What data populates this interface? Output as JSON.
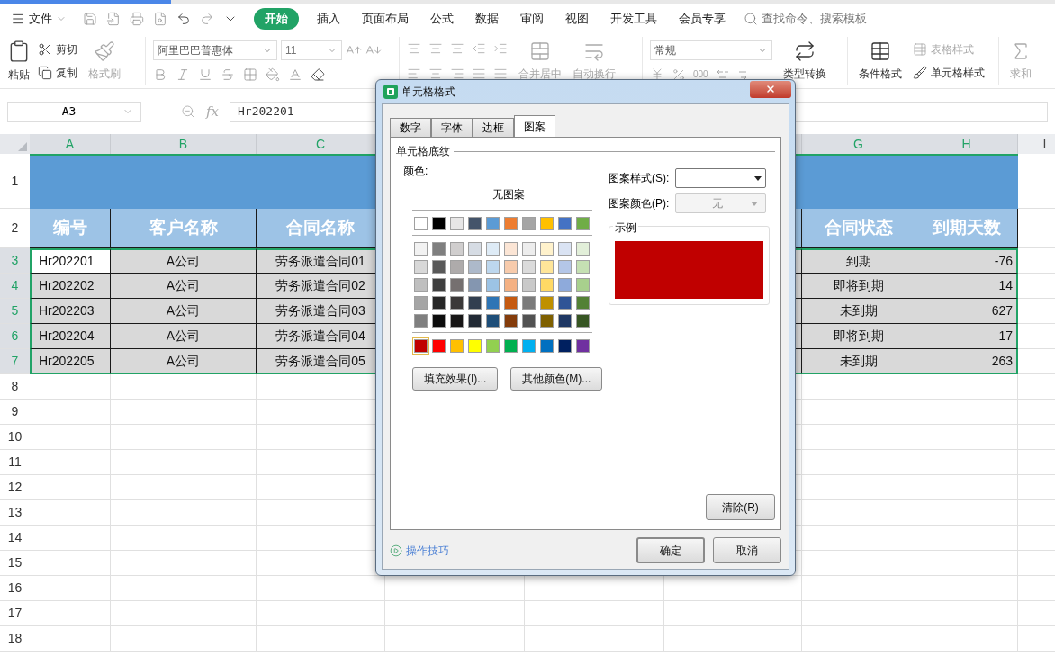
{
  "menu": {
    "file": "文件",
    "tabs": [
      {
        "label": "开始",
        "selected": true
      },
      {
        "label": "插入",
        "selected": false
      },
      {
        "label": "页面布局",
        "selected": false
      },
      {
        "label": "公式",
        "selected": false
      },
      {
        "label": "数据",
        "selected": false
      },
      {
        "label": "审阅",
        "selected": false
      },
      {
        "label": "视图",
        "selected": false
      },
      {
        "label": "开发工具",
        "selected": false
      },
      {
        "label": "会员专享",
        "selected": false
      }
    ],
    "search": {
      "placeholder": "查找命令、搜索模板"
    }
  },
  "ribbon": {
    "paste": "粘贴",
    "cut": "剪切",
    "copy": "复制",
    "format_painter": {
      "label": "格式刷",
      "disabled": true
    },
    "font_name": "阿里巴巴普惠体",
    "font_size": "11",
    "merge": {
      "label": "合并居中",
      "disabled": true
    },
    "wrap": {
      "label": "自动换行",
      "disabled": true
    },
    "number_format": "常规",
    "thousands": "000",
    "convert": "类型转换",
    "conditional": "条件格式",
    "table_style": {
      "label": "表格样式",
      "disabled": true
    },
    "cell_style": "单元格样式",
    "sum": {
      "label": "求和",
      "disabled": true
    }
  },
  "formula_bar": {
    "name_box": "A3",
    "fx": "fx",
    "value": "Hr202201"
  },
  "sheet": {
    "columns": [
      {
        "letter": "A",
        "selected": true
      },
      {
        "letter": "B",
        "selected": true
      },
      {
        "letter": "C",
        "selected": true
      },
      {
        "letter": "G",
        "selected": true
      },
      {
        "letter": "H",
        "selected": true
      },
      {
        "letter": "I",
        "selected": false
      }
    ],
    "row_numbers": [
      {
        "label": "1",
        "selected": false
      },
      {
        "label": "2",
        "selected": false
      },
      {
        "label": "3",
        "selected": true
      },
      {
        "label": "4",
        "selected": true
      },
      {
        "label": "5",
        "selected": true
      },
      {
        "label": "6",
        "selected": true
      },
      {
        "label": "7",
        "selected": true
      },
      {
        "label": "8",
        "selected": false
      },
      {
        "label": "9",
        "selected": false
      },
      {
        "label": "10",
        "selected": false
      },
      {
        "label": "11",
        "selected": false
      },
      {
        "label": "12",
        "selected": false
      },
      {
        "label": "13",
        "selected": false
      },
      {
        "label": "14",
        "selected": false
      },
      {
        "label": "15",
        "selected": false
      },
      {
        "label": "16",
        "selected": false
      },
      {
        "label": "17",
        "selected": false
      },
      {
        "label": "18",
        "selected": false
      }
    ],
    "headers": [
      "编号",
      "客户名称",
      "合同名称",
      "合同状态",
      "到期天数"
    ],
    "rows": [
      {
        "cells": [
          "Hr202201",
          "A公司",
          "劳务派遣合同01",
          "到期",
          "-76"
        ],
        "active_first": true
      },
      {
        "cells": [
          "Hr202202",
          "A公司",
          "劳务派遣合同02",
          "即将到期",
          "14"
        ],
        "active_first": false
      },
      {
        "cells": [
          "Hr202203",
          "A公司",
          "劳务派遣合同03",
          "未到期",
          "627"
        ],
        "active_first": false
      },
      {
        "cells": [
          "Hr202204",
          "A公司",
          "劳务派遣合同04",
          "即将到期",
          "17"
        ],
        "active_first": false
      },
      {
        "cells": [
          "Hr202205",
          "A公司",
          "劳务派遣合同05",
          "未到期",
          "263"
        ],
        "active_first": false
      }
    ]
  },
  "dialog": {
    "title": "单元格格式",
    "tabs": [
      {
        "label": "数字",
        "selected": false
      },
      {
        "label": "字体",
        "selected": false
      },
      {
        "label": "边框",
        "selected": false
      },
      {
        "label": "图案",
        "selected": true
      }
    ],
    "group": "单元格底纹",
    "color_label": "颜色:",
    "no_pattern": "无图案",
    "palette": [
      [
        {
          "color": "#ffffff",
          "selected": false
        },
        {
          "color": "#000000",
          "selected": false
        },
        {
          "color": "#e7e6e6",
          "selected": false
        },
        {
          "color": "#44546a",
          "selected": false
        },
        {
          "color": "#5b9bd5",
          "selected": false
        },
        {
          "color": "#ed7d31",
          "selected": false
        },
        {
          "color": "#a5a5a5",
          "selected": false
        },
        {
          "color": "#ffc000",
          "selected": false
        },
        {
          "color": "#4472c4",
          "selected": false
        },
        {
          "color": "#70ad47",
          "selected": false
        }
      ],
      [
        {
          "color": "#f2f2f2",
          "selected": false
        },
        {
          "color": "#7f7f7f",
          "selected": false
        },
        {
          "color": "#d0cece",
          "selected": false
        },
        {
          "color": "#d6dce4",
          "selected": false
        },
        {
          "color": "#deebf6",
          "selected": false
        },
        {
          "color": "#fbe5d5",
          "selected": false
        },
        {
          "color": "#ededed",
          "selected": false
        },
        {
          "color": "#fff2cc",
          "selected": false
        },
        {
          "color": "#dae3f3",
          "selected": false
        },
        {
          "color": "#e2efd9",
          "selected": false
        }
      ],
      [
        {
          "color": "#d8d8d8",
          "selected": false
        },
        {
          "color": "#595959",
          "selected": false
        },
        {
          "color": "#aeabab",
          "selected": false
        },
        {
          "color": "#adb9ca",
          "selected": false
        },
        {
          "color": "#bdd7ee",
          "selected": false
        },
        {
          "color": "#f7cbac",
          "selected": false
        },
        {
          "color": "#dbdbdb",
          "selected": false
        },
        {
          "color": "#fee599",
          "selected": false
        },
        {
          "color": "#b4c6e7",
          "selected": false
        },
        {
          "color": "#c5e0b3",
          "selected": false
        }
      ],
      [
        {
          "color": "#bfbfbf",
          "selected": false
        },
        {
          "color": "#3f3f3f",
          "selected": false
        },
        {
          "color": "#757070",
          "selected": false
        },
        {
          "color": "#8496b0",
          "selected": false
        },
        {
          "color": "#9cc3e5",
          "selected": false
        },
        {
          "color": "#f4b183",
          "selected": false
        },
        {
          "color": "#c9c9c9",
          "selected": false
        },
        {
          "color": "#ffd965",
          "selected": false
        },
        {
          "color": "#8eaadb",
          "selected": false
        },
        {
          "color": "#a8d08d",
          "selected": false
        }
      ],
      [
        {
          "color": "#a5a5a5",
          "selected": false
        },
        {
          "color": "#262626",
          "selected": false
        },
        {
          "color": "#3a3838",
          "selected": false
        },
        {
          "color": "#323f4f",
          "selected": false
        },
        {
          "color": "#2e75b5",
          "selected": false
        },
        {
          "color": "#c55a11",
          "selected": false
        },
        {
          "color": "#7b7b7b",
          "selected": false
        },
        {
          "color": "#bf9000",
          "selected": false
        },
        {
          "color": "#2f5496",
          "selected": false
        },
        {
          "color": "#538135",
          "selected": false
        }
      ],
      [
        {
          "color": "#7f7f7f",
          "selected": false
        },
        {
          "color": "#0c0c0c",
          "selected": false
        },
        {
          "color": "#171616",
          "selected": false
        },
        {
          "color": "#222a35",
          "selected": false
        },
        {
          "color": "#1e4e79",
          "selected": false
        },
        {
          "color": "#843c0b",
          "selected": false
        },
        {
          "color": "#525252",
          "selected": false
        },
        {
          "color": "#7f6000",
          "selected": false
        },
        {
          "color": "#1f3864",
          "selected": false
        },
        {
          "color": "#375623",
          "selected": false
        }
      ],
      [
        {
          "color": "#c00000",
          "selected": true
        },
        {
          "color": "#ff0000",
          "selected": false
        },
        {
          "color": "#ffc000",
          "selected": false
        },
        {
          "color": "#ffff00",
          "selected": false
        },
        {
          "color": "#92d050",
          "selected": false
        },
        {
          "color": "#00b050",
          "selected": false
        },
        {
          "color": "#00b0f0",
          "selected": false
        },
        {
          "color": "#0070c0",
          "selected": false
        },
        {
          "color": "#002060",
          "selected": false
        },
        {
          "color": "#7030a0",
          "selected": false
        }
      ]
    ],
    "fill_effects": "填充效果(I)...",
    "more_colors": "其他颜色(M)...",
    "pattern_style_label": "图案样式(S):",
    "pattern_color_label": "图案颜色(P):",
    "pattern_color": {
      "value": "无",
      "disabled": true
    },
    "sample_label": "示例",
    "clear": "清除(R)",
    "tips": "操作技巧",
    "ok": "确定",
    "cancel": "取消"
  }
}
